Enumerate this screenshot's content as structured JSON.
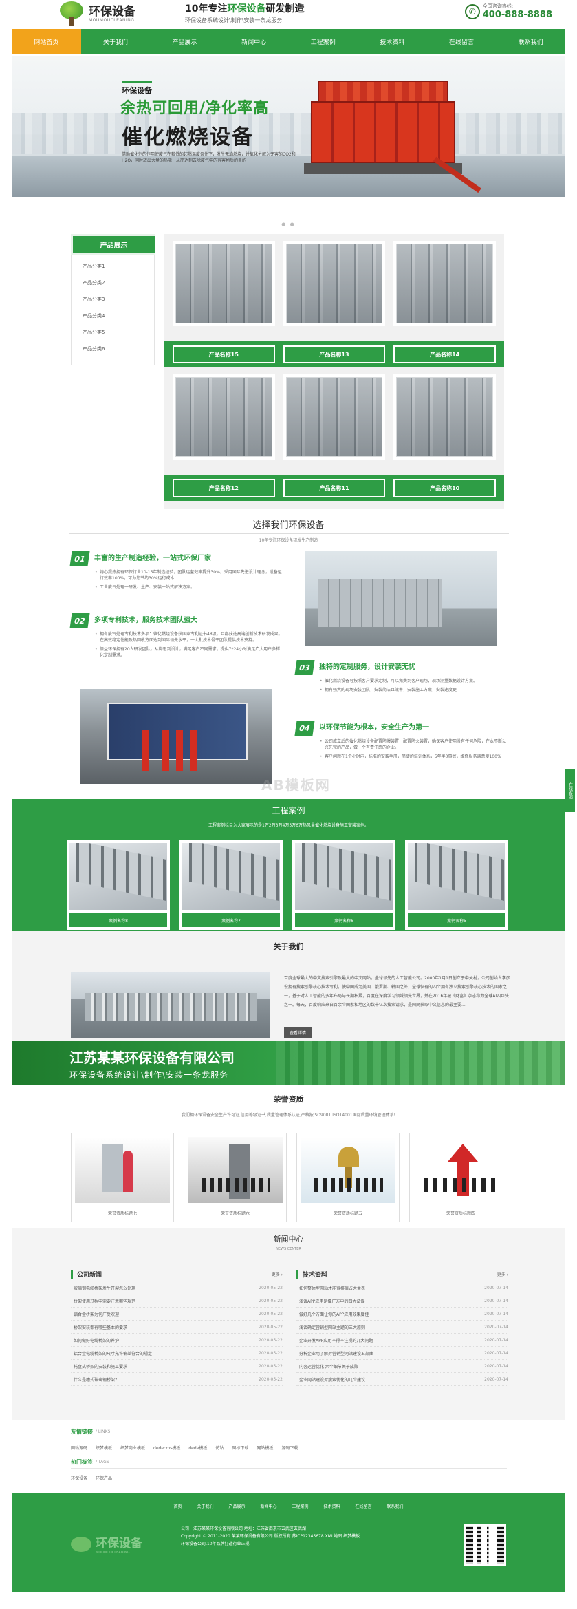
{
  "header": {
    "logo_title": "环保设备",
    "logo_sub": "MOUMOUCLEANING",
    "slogan_a": "10年专注",
    "slogan_b": "环保设备",
    "slogan_c": "研发制造",
    "slogan_sub": "环保设备系统设计\\制作\\安装一条龙服务",
    "hotline_label": "全国咨询热线:",
    "hotline": "400-888-8888"
  },
  "nav": [
    "网站首页",
    "关于我们",
    "产品展示",
    "新闻中心",
    "工程案例",
    "技术资料",
    "在线留言",
    "联系我们"
  ],
  "banner": {
    "tag": "环保设备",
    "line1": "余热可回用/净化率高",
    "line2": "催化燃烧设备",
    "desc": "借助催化剂的作用使废气在较低的起燃温度条件下，发生无焰燃烧，并氧化分解为无害的CO2和H2O，同时放出大量的热能，从而达到去除废气中的有害物质的目的"
  },
  "products": {
    "side_title": "产品展示",
    "categories": [
      "产品分类1",
      "产品分类2",
      "产品分类3",
      "产品分类4",
      "产品分类5",
      "产品分类6"
    ],
    "items": [
      "产品名称15",
      "产品名称13",
      "产品名称14",
      "产品名称12",
      "产品名称11",
      "产品名称10"
    ]
  },
  "why": {
    "title": "选择我们环保设备",
    "sub": "10年专注环保设备研发生产制造",
    "items": [
      {
        "num": "01",
        "title": "丰富的生产制造经验，一站式环保厂家",
        "points": [
          "铸心提炼拥有环保行业10-15年制造经验，团队运营效率提升30%，采用国际先进设计理念，设备运行效率100%，可为您节约30%运行成本",
          "工业废气处理一研发、生产、安装一站式解决方案。"
        ]
      },
      {
        "num": "02",
        "title": "多项专利技术，服务技术团队强大",
        "points": [
          "拥有废气处理专利技术多项：催化燃烧设备获国家专利证书48项，且都获选高端创新技术研发成果，在高效稳定性能及热回收方面达到国际领先水平，一大批技术骨干团队提供技术支持。",
          "倍益环保拥有20人研发团队，从构思到设计，满足客户不同需求；提供7*24小时满足广大用户多样化定制需求。"
        ]
      },
      {
        "num": "03",
        "title": "独特的定制服务，设计安装无忧",
        "points": [
          "催化燃烧设备可按照客户要求定制，可以免费到客户现场，现场测量数据设计方案。",
          "拥有强大的现场安装团队，安装简洁且效率，安装施工方案，安装速度更"
        ]
      },
      {
        "num": "04",
        "title": "以环保节能为根本，安全生产为第一",
        "points": [
          "公司成立后的催化燃烧设备配置防爆装置，配置防火装置，确保客户使用没有任何危险，在本不断以兴先完的产品，做一个有责任感的企业。",
          "客户问题在1个小时内，标准的安装手册，简捷的培训体系，5年半0事故，维修服务满意度100%"
        ]
      }
    ]
  },
  "cases": {
    "title": "工程案例",
    "sub": "工程案例栏目为大家展示的是1万2万3万4万5万6万热风量催化燃烧设备施工安装案例。",
    "items": [
      "案例名称8",
      "案例名称7",
      "案例名称6",
      "案例名称5"
    ]
  },
  "float_tab": "在线客服",
  "about": {
    "title": "关于我们",
    "text": "百度全球最大的中文搜索引擎及最大的中文网站，全球领先的人工智能公司。2000年1月1日创立于中关村，公司创始人李彦宏拥有搜索引擎核心技术专利，使中国成为美国、俄罗斯、韩国之外，全球仅有的四个拥有独立搜索引擎核心技术的国家之一，基于对人工智能的多年布局与长期积累，百度在深度学习领域领先世界，并在2016年被《财富》杂志称为全球AI四巨头之一。每天，百度响应来自百余个国家和地区的数十亿次搜索请求，是网民获取中文信息的最主要...",
    "more": "查看详情"
  },
  "band": {
    "company": "江苏某某环保设备有限公司",
    "tagline": "环保设备系统设计\\制作\\安装一条龙服务"
  },
  "honor": {
    "title": "荣誉资质",
    "sub": "我们拥环保设备安全生产许可证,信用等级证书,质量管理体系认证,严格按ISO9001 ISO14001国际质量环境管理体系!",
    "items": [
      "荣誉资质标题七",
      "荣誉资质标题六",
      "荣誉资质标题五",
      "荣誉资质标题四"
    ]
  },
  "news": {
    "title": "新闻中心",
    "sub": "NEWS CENTER",
    "more": "更多 ›",
    "company": {
      "title": "公司新闻",
      "rows": [
        [
          "玻璃钢电缆桥架发生开裂怎么处理",
          "2020-05-22"
        ],
        [
          "桥架使用过程中需要注意哪些规范",
          "2020-05-22"
        ],
        [
          "铝合金桥架为何广受欢迎",
          "2020-05-22"
        ],
        [
          "桥架安装都有哪些基本的要求",
          "2020-05-22"
        ],
        [
          "如何做好电缆桥架的养护",
          "2020-05-22"
        ],
        [
          "铝合金电缆桥架的尺寸允许偏差符合的规定",
          "2020-05-22"
        ],
        [
          "托盘式桥架的安装和施工要求",
          "2020-05-22"
        ],
        [
          "什么是槽式玻璃钢桥架?",
          "2020-05-22"
        ]
      ]
    },
    "tech": {
      "title": "技术资料",
      "rows": [
        [
          "如何整体型网站才能得排值占大量表",
          "2020-07-14"
        ],
        [
          "浅谈APP应用是推广方中的四大法误",
          "2020-07-14"
        ],
        [
          "做好几个方面让你的APP应用效果度佳",
          "2020-07-14"
        ],
        [
          "浅谈确定营销型网站主题的三大原则",
          "2020-07-14"
        ],
        [
          "企业开发APP应用不得不注视的几大问题",
          "2020-07-14"
        ],
        [
          "分析企业用了解对营销型网站建设五部曲",
          "2020-07-14"
        ],
        [
          "内容运营优化 六个细节关乎成败",
          "2020-07-14"
        ],
        [
          "企业网站建设对搜索优化的几个建议",
          "2020-07-14"
        ]
      ]
    }
  },
  "links": {
    "title": "友情链接",
    "en": "/ LINKS",
    "items": [
      "网站源码",
      "织梦模板",
      "织梦商业模板",
      "dedecms模板",
      "dede模板",
      "仿站",
      "图标下载",
      "网站模板",
      "源码下载"
    ]
  },
  "tags": {
    "title": "热门标签",
    "en": "/ TAGS",
    "items": [
      "环保设备",
      "环保产品"
    ]
  },
  "footer": {
    "nav": [
      "首页",
      "关于我们",
      "产品展示",
      "新闻中心",
      "工程案例",
      "技术资料",
      "在线留言",
      "联系我们"
    ],
    "logo": "环保设备",
    "logo_sub": "MOUMOUCLEANING",
    "line1": "公司：江苏某某环保设备有限公司 地址：江苏省南京市玄武区玄武湖",
    "line2": "Copyright © 2011-2020 某某环保设备有限公司 版权所有 苏ICP12345678 XML地图 织梦模板",
    "line3": "环保设备公司,10年品牌打造行业正规!"
  },
  "watermark": "AB模板网"
}
